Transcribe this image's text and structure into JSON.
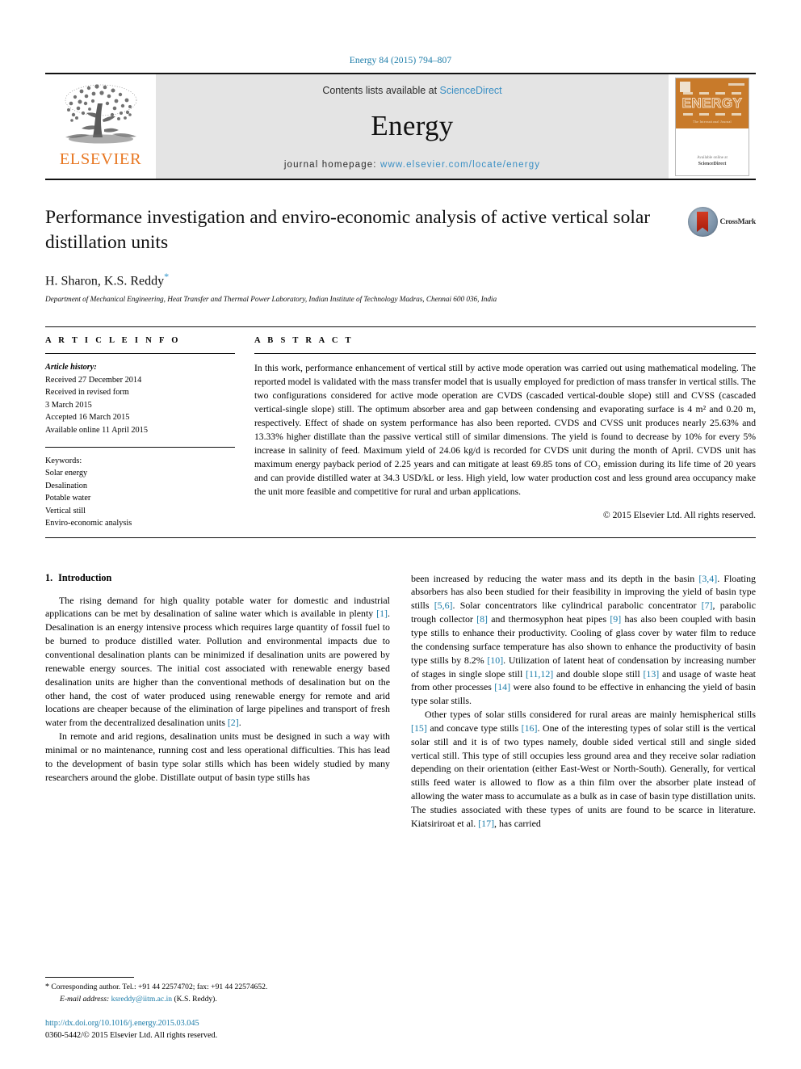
{
  "running_head": "Energy 84 (2015) 794–807",
  "masthead": {
    "contents_prefix": "Contents lists available at ",
    "sciencedirect": "ScienceDirect",
    "journal_name": "Energy",
    "homepage_prefix": "journal homepage: ",
    "homepage_url": "www.elsevier.com/locate/energy",
    "publisher_wordmark": "ELSEVIER",
    "cover_title": "ENERGY",
    "cover_subtitle": "The International Journal",
    "cover_footer_small": "Available online at",
    "cover_footer_brand": "ScienceDirect"
  },
  "article": {
    "title": "Performance investigation and enviro-economic analysis of active vertical solar distillation units",
    "authors": "H. Sharon, K.S. Reddy",
    "corresponding_marker": "*",
    "affiliation": "Department of Mechanical Engineering, Heat Transfer and Thermal Power Laboratory, Indian Institute of Technology Madras, Chennai 600 036, India",
    "crossmark_label": "CrossMark"
  },
  "article_info": {
    "heading": "A R T I C L E  I N F O",
    "history_label": "Article history:",
    "history": [
      "Received 27 December 2014",
      "Received in revised form",
      "3 March 2015",
      "Accepted 16 March 2015",
      "Available online 11 April 2015"
    ],
    "keywords_label": "Keywords:",
    "keywords": [
      "Solar energy",
      "Desalination",
      "Potable water",
      "Vertical still",
      "Enviro-economic analysis"
    ]
  },
  "abstract": {
    "heading": "A B S T R A C T",
    "text": "In this work, performance enhancement of vertical still by active mode operation was carried out using mathematical modeling. The reported model is validated with the mass transfer model that is usually employed for prediction of mass transfer in vertical stills. The two configurations considered for active mode operation are CVDS (cascaded vertical-double slope) still and CVSS (cascaded vertical-single slope) still. The optimum absorber area and gap between condensing and evaporating surface is 4 m² and 0.20 m, respectively. Effect of shade on system performance has also been reported. CVDS and CVSS unit produces nearly 25.63% and 13.33% higher distillate than the passive vertical still of similar dimensions. The yield is found to decrease by 10% for every 5% increase in salinity of feed. Maximum yield of 24.06 kg/d is recorded for CVDS unit during the month of April. CVDS unit has maximum energy payback period of 2.25 years and can mitigate at least 69.85 tons of CO₂ emission during its life time of 20 years and can provide distilled water at 34.3 USD/kL or less. High yield, low water production cost and less ground area occupancy make the unit more feasible and competitive for rural and urban applications.",
    "copyright": "© 2015 Elsevier Ltd. All rights reserved."
  },
  "body": {
    "section_number": "1.",
    "section_title": "Introduction",
    "left_paragraphs": [
      "The rising demand for high quality potable water for domestic and industrial applications can be met by desalination of saline water which is available in plenty [1]. Desalination is an energy intensive process which requires large quantity of fossil fuel to be burned to produce distilled water. Pollution and environmental impacts due to conventional desalination plants can be minimized if desalination units are powered by renewable energy sources. The initial cost associated with renewable energy based desalination units are higher than the conventional methods of desalination but on the other hand, the cost of water produced using renewable energy for remote and arid locations are cheaper because of the elimination of large pipelines and transport of fresh water from the decentralized desalination units [2].",
      "In remote and arid regions, desalination units must be designed in such a way with minimal or no maintenance, running cost and less operational difficulties. This has lead to the development of basin type solar stills which has been widely studied by many researchers around the globe. Distillate output of basin type stills has"
    ],
    "right_paragraphs": [
      "been increased by reducing the water mass and its depth in the basin [3,4]. Floating absorbers has also been studied for their feasibility in improving the yield of basin type stills [5,6]. Solar concentrators like cylindrical parabolic concentrator [7], parabolic trough collector [8] and thermosyphon heat pipes [9] has also been coupled with basin type stills to enhance their productivity. Cooling of glass cover by water film to reduce the condensing surface temperature has also shown to enhance the productivity of basin type stills by 8.2% [10]. Utilization of latent heat of condensation by increasing number of stages in single slope still [11,12] and double slope still [13] and usage of waste heat from other processes [14] were also found to be effective in enhancing the yield of basin type solar stills.",
      "Other types of solar stills considered for rural areas are mainly hemispherical stills [15] and concave type stills [16]. One of the interesting types of solar still is the vertical solar still and it is of two types namely, double sided vertical still and single sided vertical still. This type of still occupies less ground area and they receive solar radiation depending on their orientation (either East-West or North-South). Generally, for vertical stills feed water is allowed to flow as a thin film over the absorber plate instead of allowing the water mass to accumulate as a bulk as in case of basin type distillation units. The studies associated with these types of units are found to be scarce in literature. Kiatsiriroat et al. [17], has carried"
    ]
  },
  "footnotes": {
    "corresponding": "Corresponding author. Tel.: +91 44 22574702; fax: +91 44 22574652.",
    "email_label": "E-mail address:",
    "email": "ksreddy@iitm.ac.in",
    "email_suffix": "(K.S. Reddy).",
    "doi": "http://dx.doi.org/10.1016/j.energy.2015.03.045",
    "issn_line": "0360-5442/© 2015 Elsevier Ltd. All rights reserved."
  },
  "colors": {
    "link": "#1a7ba8",
    "elsevier_orange": "#E87722",
    "masthead_grey": "#e4e4e4"
  }
}
